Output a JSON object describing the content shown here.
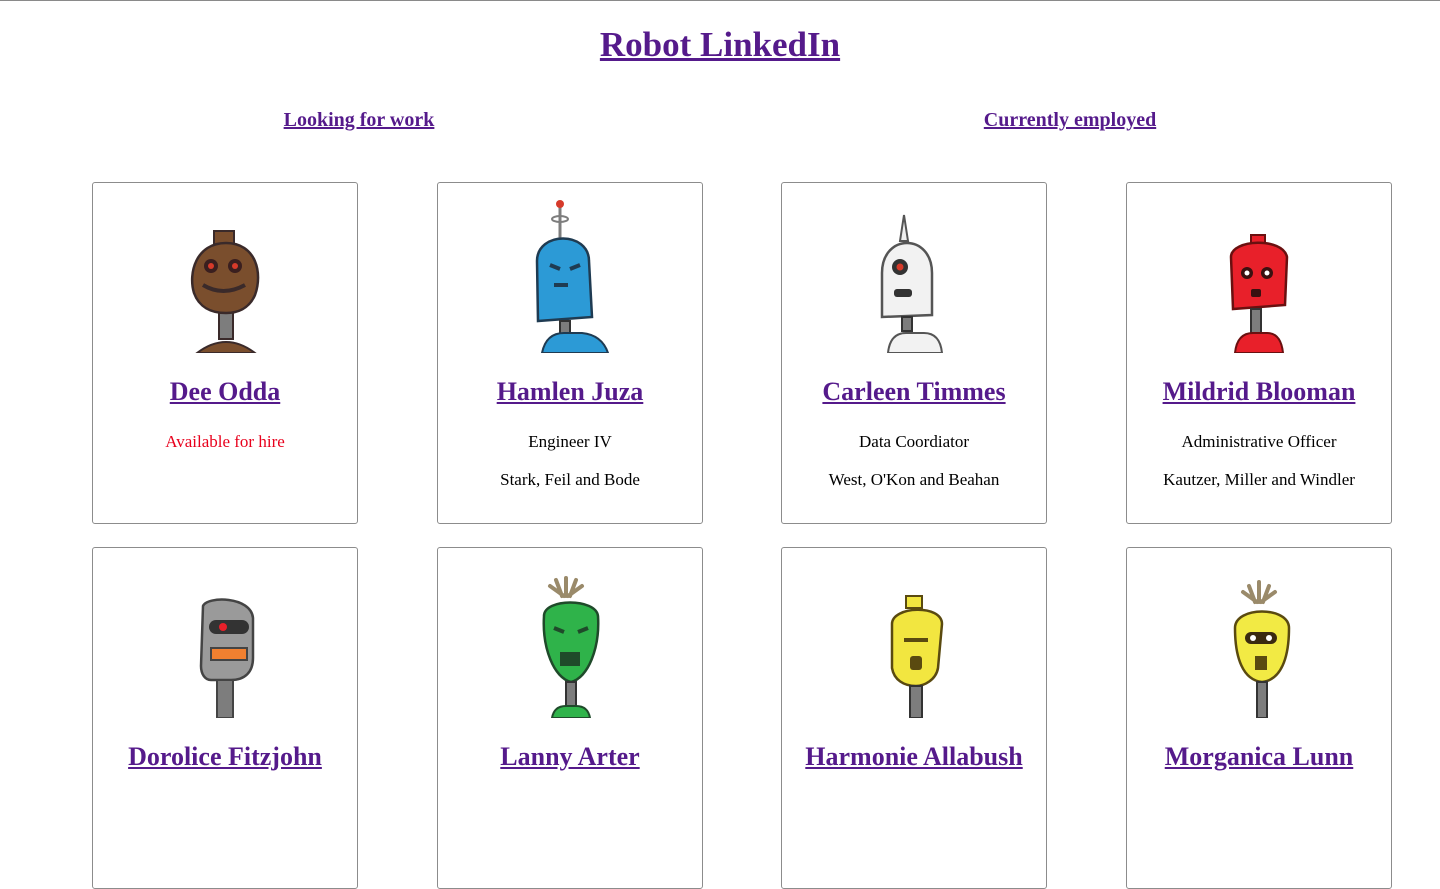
{
  "header": {
    "title": "Robot LinkedIn"
  },
  "nav": {
    "looking": "Looking for work",
    "employed": "Currently employed"
  },
  "colors": {
    "link": "#551a8b",
    "available": "#e8001c"
  },
  "robots": [
    {
      "name": "Dee Odda",
      "line1": "Available for hire",
      "line2": "",
      "color": "#7a4e2d",
      "icon": "brown-robot-icon"
    },
    {
      "name": "Hamlen Juza",
      "line1": "Engineer IV",
      "line2": "Stark, Feil and Bode",
      "color": "#2c9ad6",
      "icon": "blue-robot-icon"
    },
    {
      "name": "Carleen Timmes",
      "line1": "Data Coordiator",
      "line2": "West, O'Kon and Beahan",
      "color": "#f2f2f2",
      "icon": "white-robot-icon"
    },
    {
      "name": "Mildrid Blooman",
      "line1": "Administrative Officer",
      "line2": "Kautzer, Miller and Windler",
      "color": "#e8202a",
      "icon": "red-robot-icon"
    },
    {
      "name": "Dorolice Fitzjohn",
      "line1": "",
      "line2": "",
      "color": "#9a9a9a",
      "icon": "gray-robot-icon"
    },
    {
      "name": "Lanny Arter",
      "line1": "",
      "line2": "",
      "color": "#2fb34a",
      "icon": "green-robot-icon"
    },
    {
      "name": "Harmonie Allabush",
      "line1": "",
      "line2": "",
      "color": "#f2e640",
      "icon": "yellow-robot-icon"
    },
    {
      "name": "Morganica Lunn",
      "line1": "",
      "line2": "",
      "color": "#f2ea44",
      "icon": "yellow-robot-icon"
    }
  ]
}
